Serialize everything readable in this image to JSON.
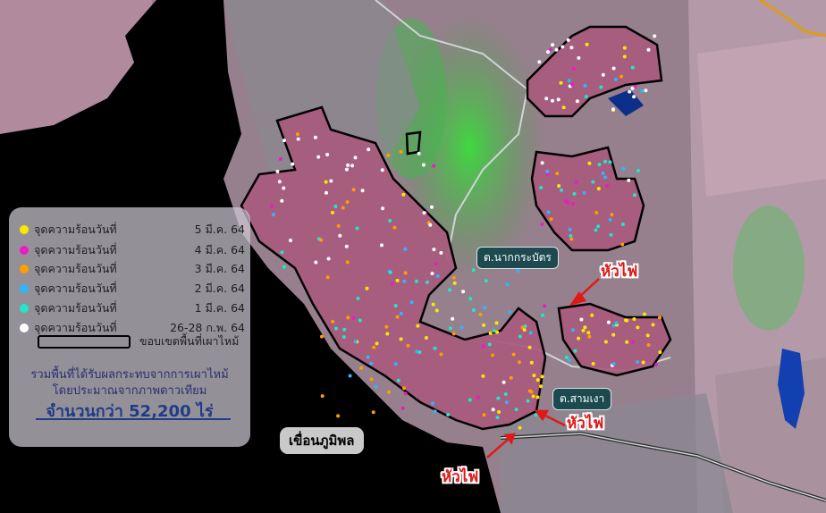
{
  "colors": {
    "day_5_mar": "#ffe600",
    "day_4_mar": "#e81ec2",
    "day_3_mar": "#ff9d00",
    "day_2_mar": "#2fb5ff",
    "day_1_mar": "#22e6c9",
    "day_26_28_feb": "#ffffff",
    "burn_boundary": "#000000",
    "fire_arrow": "#e01818"
  },
  "legend": {
    "items": [
      {
        "label": "จุดความร้อนวันที่",
        "date": "5 มี.ค. 64",
        "color": "#ffe600"
      },
      {
        "label": "จุดความร้อนวันที่",
        "date": "4 มี.ค. 64",
        "color": "#e81ec2"
      },
      {
        "label": "จุดความร้อนวันที่",
        "date": "3 มี.ค. 64",
        "color": "#ff9d00"
      },
      {
        "label": "จุดความร้อนวันที่",
        "date": "2 มี.ค. 64",
        "color": "#2fb5ff"
      },
      {
        "label": "จุดความร้อนวันที่",
        "date": "1 มี.ค. 64",
        "color": "#22e6c9"
      },
      {
        "label": "จุดความร้อนวันที่",
        "date": "26-28 ก.พ. 64",
        "color": "#ffffff"
      }
    ],
    "boundary_label": "ขอบเขตพื้นที่เผาไหม้"
  },
  "summary": {
    "line1": "รวมพื้นที่ได้รับผลกระทบจากการเผาไหม้",
    "line2": "โดยประมาณจากภาพดาวเทียม",
    "line3": "จำนวนกว่า 52,200 ไร่"
  },
  "places": {
    "tambon_na_kradat": "ต.นากกระบัตร",
    "tambon_sam_ngao": "ต.สามเงา",
    "dam": "เขื่อนภูมิพล"
  },
  "fire_front_label": "หัวไฟ"
}
